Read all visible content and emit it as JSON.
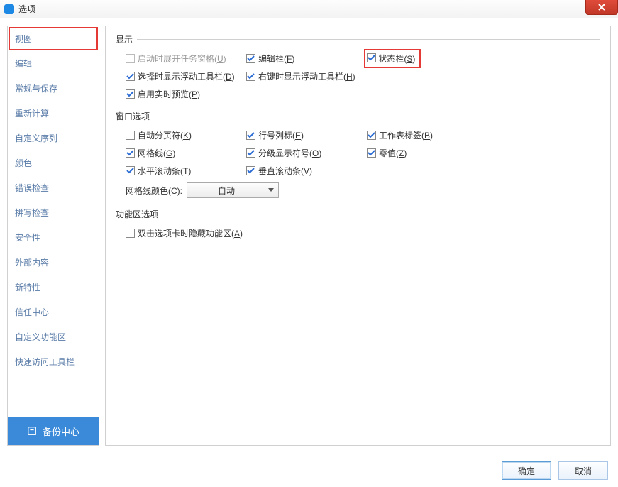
{
  "title": "选项",
  "sidebar": {
    "items": [
      "视图",
      "编辑",
      "常规与保存",
      "重新计算",
      "自定义序列",
      "颜色",
      "错误检查",
      "拼写检查",
      "安全性",
      "外部内容",
      "新特性",
      "信任中心",
      "自定义功能区",
      "快速访问工具栏"
    ],
    "selected_index": 0,
    "backup_label": "备份中心"
  },
  "sections": {
    "display": {
      "title": "显示",
      "items": {
        "startup_taskpane": {
          "label": "启动时展开任务窗格(",
          "shortcut": "U",
          "suffix": ")",
          "checked": false,
          "disabled": true
        },
        "formula_bar": {
          "label": "编辑栏(",
          "shortcut": "F",
          "suffix": ")",
          "checked": true
        },
        "status_bar": {
          "label": "状态栏(",
          "shortcut": "S",
          "suffix": ")",
          "checked": true,
          "highlighted": true
        },
        "float_toolbar": {
          "label": "选择时显示浮动工具栏(",
          "shortcut": "D",
          "suffix": ")",
          "checked": true
        },
        "rclick_toolbar": {
          "label": "右键时显示浮动工具栏(",
          "shortcut": "H",
          "suffix": ")",
          "checked": true
        },
        "live_preview": {
          "label": "启用实时预览(",
          "shortcut": "P",
          "suffix": ")",
          "checked": true
        }
      }
    },
    "window": {
      "title": "窗口选项",
      "items": {
        "page_breaks": {
          "label": "自动分页符(",
          "shortcut": "K",
          "suffix": ")",
          "checked": false
        },
        "row_col_hdr": {
          "label": "行号列标(",
          "shortcut": "E",
          "suffix": ")",
          "checked": true
        },
        "sheet_tabs": {
          "label": "工作表标签(",
          "shortcut": "B",
          "suffix": ")",
          "checked": true
        },
        "gridlines": {
          "label": "网格线(",
          "shortcut": "G",
          "suffix": ")",
          "checked": true
        },
        "outline_sym": {
          "label": "分级显示符号(",
          "shortcut": "O",
          "suffix": ")",
          "checked": true
        },
        "zero_values": {
          "label": "零值(",
          "shortcut": "Z",
          "suffix": ")",
          "checked": true
        },
        "hscroll": {
          "label": "水平滚动条(",
          "shortcut": "T",
          "suffix": ")",
          "checked": true
        },
        "vscroll": {
          "label": "垂直滚动条(",
          "shortcut": "V",
          "suffix": ")",
          "checked": true
        }
      },
      "gridline_color": {
        "label": "网格线颜色(",
        "shortcut": "C",
        "suffix": "):",
        "value": "自动"
      }
    },
    "ribbon": {
      "title": "功能区选项",
      "items": {
        "dblclick_hide": {
          "label": "双击选项卡时隐藏功能区(",
          "shortcut": "A",
          "suffix": ")",
          "checked": false
        }
      }
    }
  },
  "buttons": {
    "ok": "确定",
    "cancel": "取消"
  }
}
